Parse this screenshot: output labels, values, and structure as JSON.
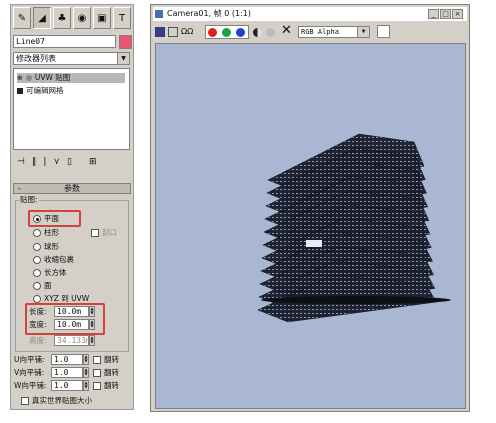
{
  "command_panel": {
    "object_name": "Line07",
    "name_color": "#e8566e",
    "modifier_list_label": "修改器列表",
    "stack": [
      {
        "label": "UVW 贴图",
        "icon": "light-bulb-icon"
      },
      {
        "label": "可编辑网格",
        "icon": "square-icon"
      }
    ],
    "params": {
      "title": "参数",
      "group_label": "贴图:",
      "planar": "平面",
      "cylindrical": "柱形",
      "cap": "封口",
      "spherical": "球形",
      "shrink_wrap": "收缩包裹",
      "box": "长方体",
      "face": "面",
      "xyz_to_uvw": "XYZ 到 UVW",
      "length_label": "长度:",
      "length_value": "10.0m",
      "width_label": "宽度:",
      "width_value": "10.0m",
      "height_label": "高度:",
      "height_value": "34.133m",
      "u_tile_label": "U向平铺:",
      "u_tile_value": "1.0",
      "v_tile_label": "V向平铺:",
      "v_tile_value": "1.0",
      "w_tile_label": "W向平铺:",
      "w_tile_value": "1.0",
      "flip": "翻转",
      "real_world": "真实世界贴图大小"
    }
  },
  "render_window": {
    "title": "Camera01, 帧 0 (1:1)",
    "channel": "RGB Alpha",
    "viewport_color": "#a9b7d3",
    "window_buttons": [
      "minimize-icon",
      "maximize-icon",
      "close-icon"
    ]
  },
  "colors": {
    "highlight": "#d8403a",
    "red_channel": "#e02020",
    "green_channel": "#20a040",
    "blue_channel": "#2040d0"
  }
}
